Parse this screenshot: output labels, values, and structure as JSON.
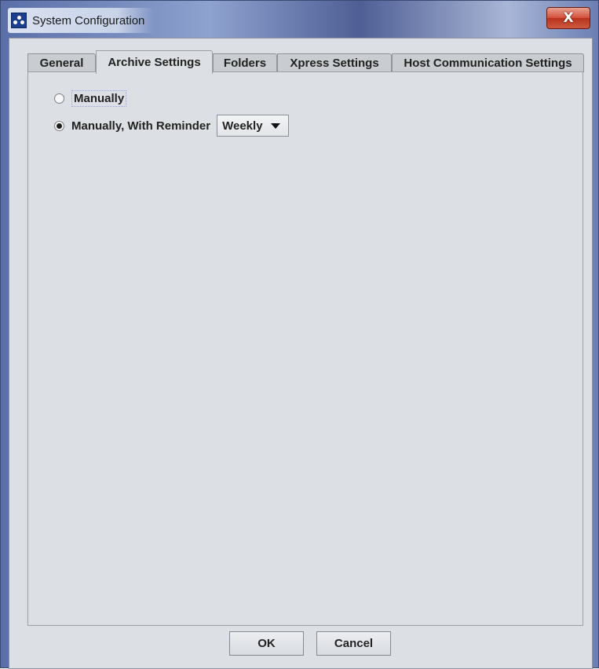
{
  "window": {
    "title": "System Configuration",
    "close_label": "X"
  },
  "tabs": [
    {
      "label": "General",
      "active": false
    },
    {
      "label": "Archive Settings",
      "active": true
    },
    {
      "label": "Folders",
      "active": false
    },
    {
      "label": "Xpress Settings",
      "active": false
    },
    {
      "label": "Host Communication Settings",
      "active": false
    }
  ],
  "archive": {
    "options": [
      {
        "label": "Manually",
        "checked": false
      },
      {
        "label": "Manually, With Reminder",
        "checked": true
      }
    ],
    "reminder_frequency": "Weekly"
  },
  "buttons": {
    "ok_label": "OK",
    "cancel_label": "Cancel"
  }
}
